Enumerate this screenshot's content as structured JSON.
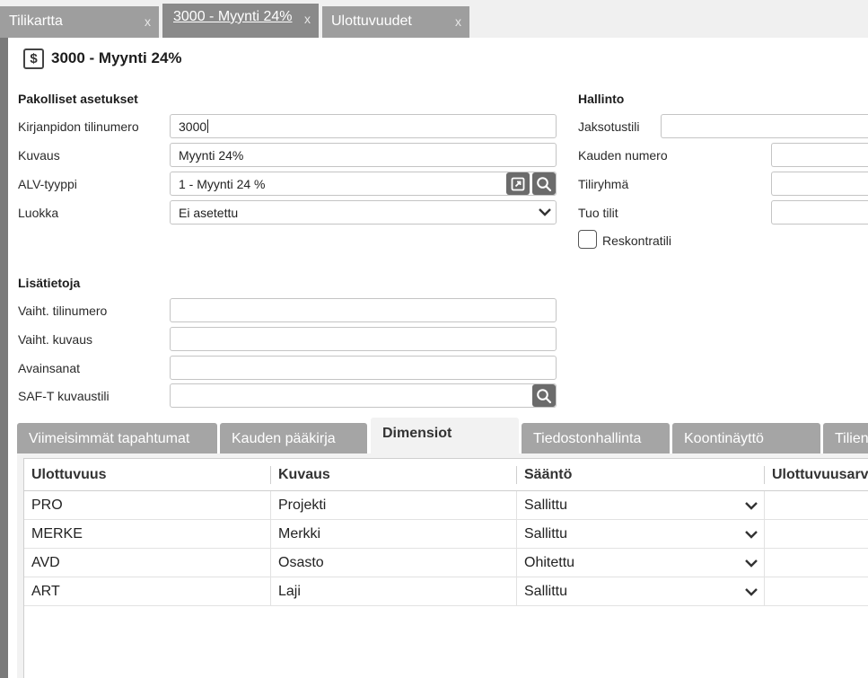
{
  "top_tabs": [
    {
      "label": "Tilikartta",
      "close": "x"
    },
    {
      "label": "3000 - Myynti 24%",
      "close": "x"
    },
    {
      "label": "Ulottuvuudet",
      "close": "x"
    }
  ],
  "page_title": "3000 - Myynti 24%",
  "title_icon": "$",
  "required": {
    "heading": "Pakolliset asetukset",
    "account_number_label": "Kirjanpidon tilinumero",
    "account_number_value": "3000",
    "description_label": "Kuvaus",
    "description_value": "Myynti 24%",
    "vat_type_label": "ALV-tyyppi",
    "vat_type_value": "1 - Myynti 24 %",
    "class_label": "Luokka",
    "class_value": "Ei asetettu"
  },
  "admin": {
    "heading": "Hallinto",
    "accrual_label": "Jaksotustili",
    "accrual_value": "",
    "period_label": "Kauden numero",
    "period_value": "",
    "group_label": "Tiliryhmä",
    "group_value": "",
    "import_label": "Tuo tilit",
    "import_value": "",
    "ledger_label": "Reskontratili",
    "ledger_checked": false
  },
  "extra": {
    "heading": "Lisätietoja",
    "alt_number_label": "Vaiht. tilinumero",
    "alt_number_value": "",
    "alt_desc_label": "Vaiht. kuvaus",
    "alt_desc_value": "",
    "keywords_label": "Avainsanat",
    "keywords_value": "",
    "saft_label": "SAF-T kuvaustili",
    "saft_value": ""
  },
  "bottom_tabs": [
    {
      "label": "Viimeisimmät tapahtumat"
    },
    {
      "label": "Kauden pääkirja"
    },
    {
      "label": "Dimensiot"
    },
    {
      "label": "Tiedostonhallinta"
    },
    {
      "label": "Koontinäyttö"
    },
    {
      "label": "Tilien"
    }
  ],
  "grid": {
    "columns": [
      "Ulottuvuus",
      "Kuvaus",
      "Sääntö",
      "Ulottuvuusarvo"
    ],
    "rows": [
      {
        "dimension": "PRO",
        "description": "Projekti",
        "rule": "Sallittu"
      },
      {
        "dimension": "MERKE",
        "description": "Merkki",
        "rule": "Sallittu"
      },
      {
        "dimension": "AVD",
        "description": "Osasto",
        "rule": "Ohitettu"
      },
      {
        "dimension": "ART",
        "description": "Laji",
        "rule": "Sallittu"
      }
    ]
  },
  "colors": {
    "highlight": "#fbe98a",
    "tab": "#9e9e9e",
    "active_tab": "#8a8a8a"
  }
}
